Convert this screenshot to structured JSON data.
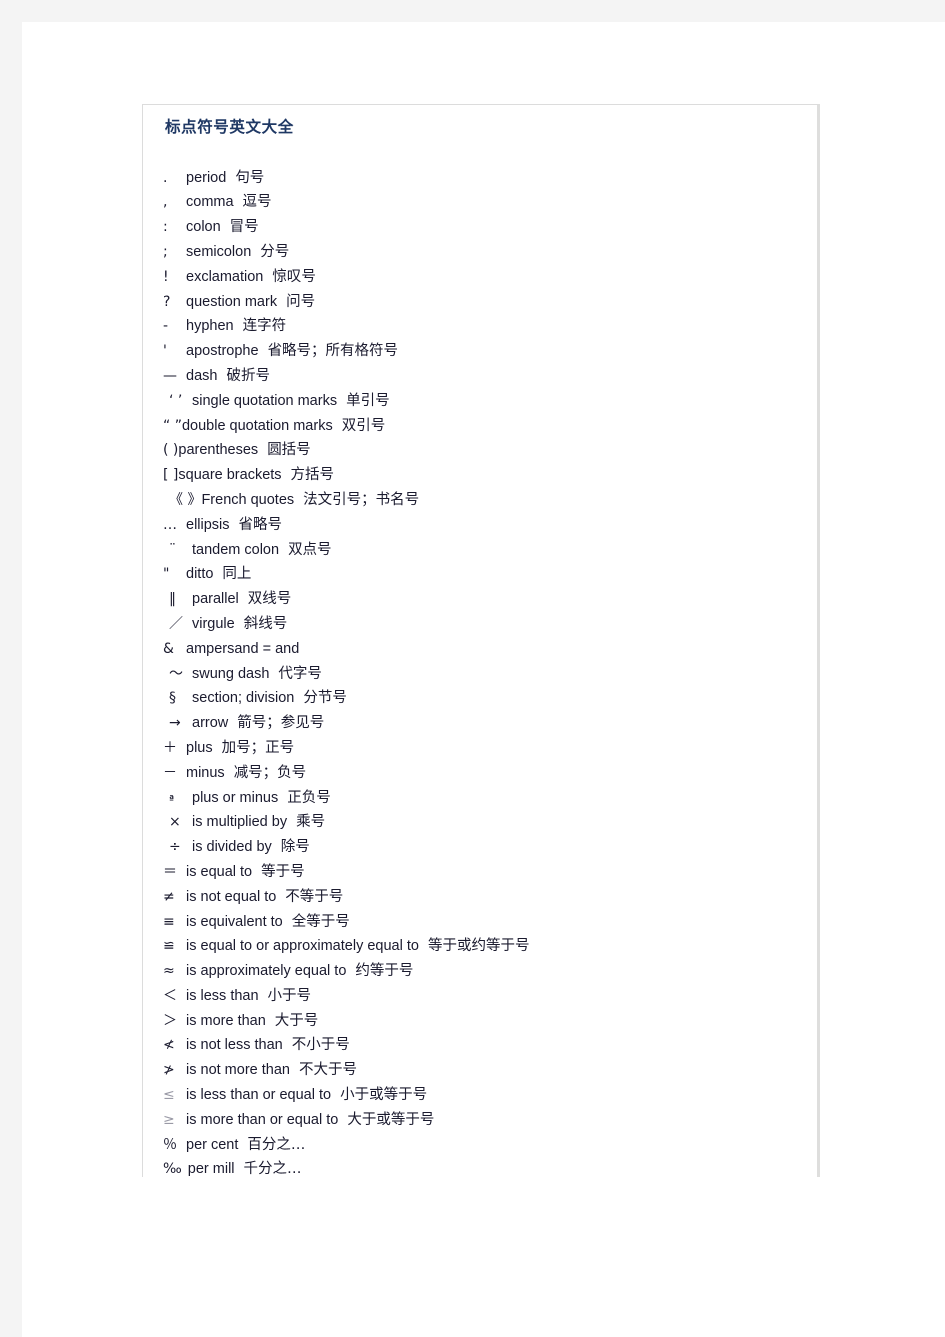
{
  "document": {
    "title": "标点符号英文大全",
    "title_color": "#1f3864",
    "body_color": "#1a1a2e",
    "page_background": "#ffffff",
    "gutter_color": "#f4f4f4",
    "frame_border_color": "#dcdcdc"
  },
  "symbols": [
    {
      "glyph": ".",
      "english": "period",
      "chinese": "句号"
    },
    {
      "glyph": ",",
      "english": "comma",
      "chinese": "逗号"
    },
    {
      "glyph": ":",
      "english": "colon",
      "chinese": "冒号"
    },
    {
      "glyph": ";",
      "english": "semicolon",
      "chinese": "分号"
    },
    {
      "glyph": "!",
      "english": "exclamation",
      "chinese": "惊叹号"
    },
    {
      "glyph": "?",
      "english": "question mark",
      "chinese": "问号"
    },
    {
      "glyph": "-",
      "english": "hyphen",
      "chinese": "连字符"
    },
    {
      "glyph": "'",
      "english": "apostrophe",
      "chinese": "省略号；所有格符号"
    },
    {
      "glyph": "—",
      "english": "dash",
      "chinese": "破折号"
    },
    {
      "glyph": "‘ ’",
      "english": "single quotation marks",
      "chinese": "单引号"
    },
    {
      "glyph": "“ ”",
      "english": "double quotation marks",
      "chinese": "双引号"
    },
    {
      "glyph": "( )",
      "english": "parentheses",
      "chinese": "圆括号"
    },
    {
      "glyph": "[ ]",
      "english": "square brackets",
      "chinese": "方括号"
    },
    {
      "glyph": "《 》",
      "english": "French quotes",
      "chinese": "法文引号；书名号"
    },
    {
      "glyph": "…",
      "english": "ellipsis",
      "chinese": "省略号"
    },
    {
      "glyph": "¨",
      "english": "tandem colon",
      "chinese": "双点号"
    },
    {
      "glyph": "\"",
      "english": "ditto",
      "chinese": "同上"
    },
    {
      "glyph": "‖",
      "english": "parallel",
      "chinese": "双线号"
    },
    {
      "glyph": "／",
      "english": "virgule",
      "chinese": "斜线号"
    },
    {
      "glyph": "&",
      "english": "ampersand = and",
      "chinese": ""
    },
    {
      "glyph": "～",
      "english": "swung dash",
      "chinese": "代字号"
    },
    {
      "glyph": "§",
      "english": "section; division",
      "chinese": "分节号"
    },
    {
      "glyph": "→",
      "english": "arrow",
      "chinese": "箭号；参见号"
    },
    {
      "glyph": "＋",
      "english": "plus",
      "chinese": "加号；正号"
    },
    {
      "glyph": "－",
      "english": "minus",
      "chinese": "减号；负号"
    },
    {
      "glyph": "ª",
      "english": "plus or minus",
      "chinese": "正负号"
    },
    {
      "glyph": "×",
      "english": "is multiplied by",
      "chinese": "乘号"
    },
    {
      "glyph": "÷",
      "english": "is divided by",
      "chinese": "除号"
    },
    {
      "glyph": "＝",
      "english": "is equal to",
      "chinese": "等于号"
    },
    {
      "glyph": "≠",
      "english": "is not equal to",
      "chinese": "不等于号"
    },
    {
      "glyph": "≡",
      "english": "is equivalent to",
      "chinese": "全等于号"
    },
    {
      "glyph": "≌",
      "english": "is equal to or approximately equal to",
      "chinese": "等于或约等于号"
    },
    {
      "glyph": "≈",
      "english": "is approximately equal to",
      "chinese": "约等于号"
    },
    {
      "glyph": "＜",
      "english": "is less than",
      "chinese": "小于号"
    },
    {
      "glyph": "＞",
      "english": "is more than",
      "chinese": "大于号"
    },
    {
      "glyph": "≮",
      "english": "is not less than",
      "chinese": "不小于号"
    },
    {
      "glyph": "≯",
      "english": "is not more than",
      "chinese": "不大于号"
    },
    {
      "glyph": "≤",
      "english": "is less than or equal to",
      "chinese": "小于或等于号"
    },
    {
      "glyph": "≥",
      "english": "is more than or equal to",
      "chinese": "大于或等于号"
    },
    {
      "glyph": "％",
      "english": "per cent",
      "chinese": "百分之…"
    },
    {
      "glyph": "‰",
      "english": "per mill",
      "chinese": "千分之…"
    }
  ]
}
